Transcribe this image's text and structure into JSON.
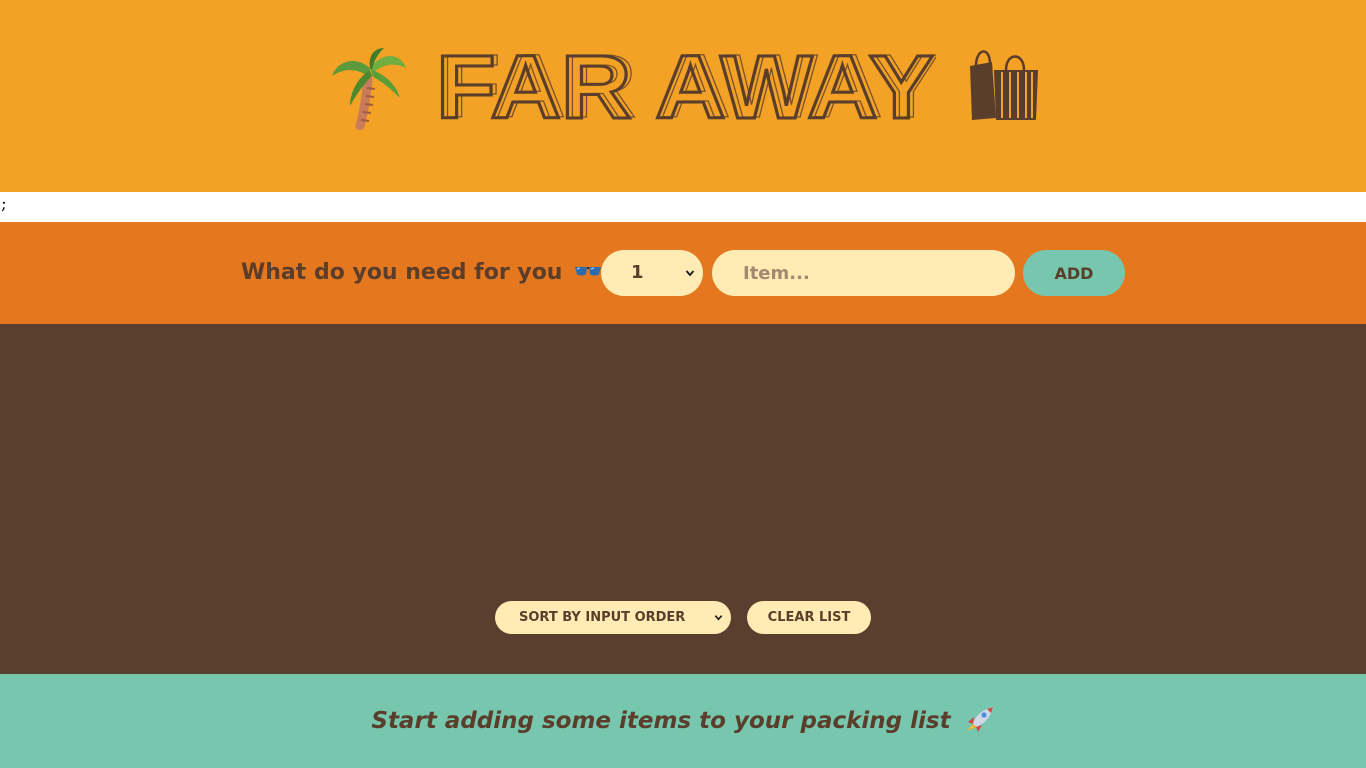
{
  "header": {
    "title": "FAR AWAY",
    "left_icon": "palm-tree-icon",
    "right_icon": "shopping-bags-icon"
  },
  "stray_text": ";",
  "add_form": {
    "question": "What do you need for you",
    "question_icon": "sunglasses-icon",
    "quantity_selected": "1",
    "item_placeholder": "Item...",
    "item_value": "",
    "add_label": "ADD"
  },
  "list": {
    "items": [],
    "sort_selected": "SORT BY INPUT ORDER",
    "clear_label": "CLEAR LIST"
  },
  "footer": {
    "message": "Start adding some items to your packing list",
    "icon": "rocket-icon"
  },
  "colors": {
    "header_bg": "#f4a226",
    "form_bg": "#e5771f",
    "list_bg": "#5a3e2e",
    "footer_bg": "#76c7ad",
    "input_bg": "#ffebb3",
    "text_brown": "#5a3e2b",
    "accent_teal": "#76c7ad"
  }
}
